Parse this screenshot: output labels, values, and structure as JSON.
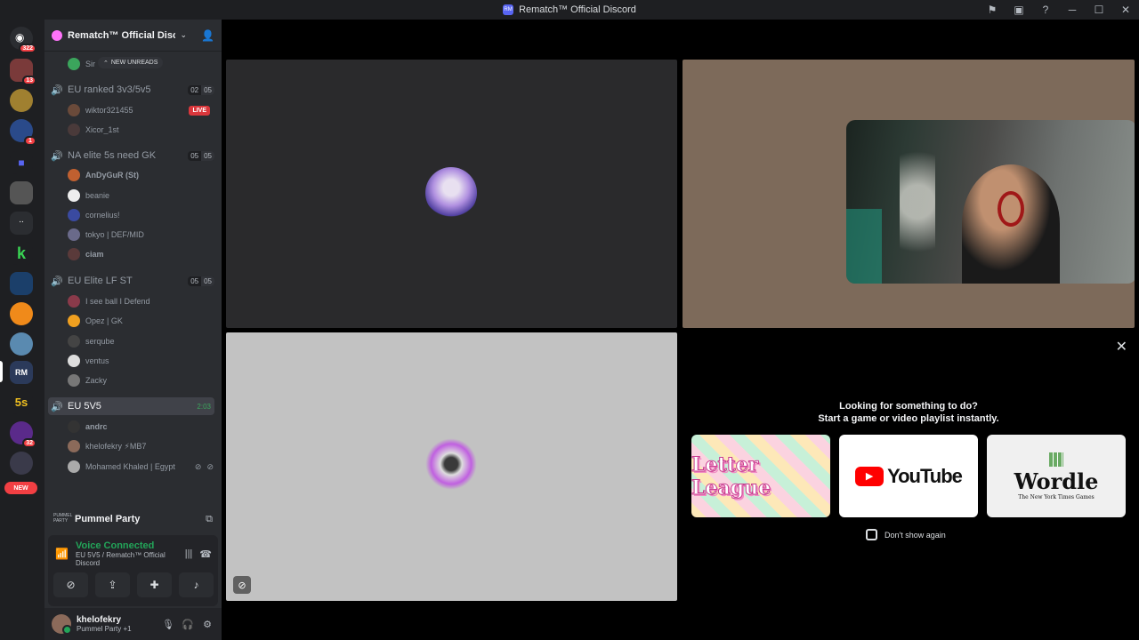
{
  "window": {
    "title": "Rematch™ Official Discord"
  },
  "guilds": {
    "home_badge": "322",
    "items": [
      {
        "badge": "13"
      },
      {
        "badge": ""
      },
      {
        "badge": "1"
      },
      {
        "badge": ""
      },
      {
        "badge": ""
      },
      {
        "badge": ""
      },
      {
        "badge": ""
      },
      {
        "badge": ""
      },
      {
        "badge": ""
      },
      {
        "badge": ""
      },
      {
        "badge": ""
      },
      {
        "badge": ""
      },
      {
        "badge": "32"
      },
      {
        "badge": ""
      }
    ],
    "new_label": "NEW"
  },
  "server": {
    "name": "Rematch™ Official Disco...",
    "new_unreads": "NEW UNREADS",
    "partial_member": "Sir"
  },
  "voice_channels": [
    {
      "name": "EU ranked 3v3/5v5",
      "count": "02",
      "limit": "05",
      "members": [
        "wiktor321455",
        "Xicor_1st"
      ],
      "live": "LIVE"
    },
    {
      "name": "NA elite 5s need GK",
      "count": "05",
      "limit": "05",
      "members": [
        "AnDyGuR (St)",
        "beanie",
        "cornelius!",
        "tokyo | DEF/MID",
        "ciam"
      ]
    },
    {
      "name": "EU Elite LF ST",
      "count": "05",
      "limit": "05",
      "members": [
        "I see ball I Defend",
        "Opez | GK",
        "serqube",
        "ventus",
        "Zacky"
      ]
    },
    {
      "name": "EU 5V5",
      "timer": "2:03",
      "members": [
        "andrc",
        "khelofekry ⚡MB7",
        "Mohamed Khaled | Egypt"
      ]
    }
  ],
  "activity": {
    "name": "Pummel Party",
    "icon_text": "PUMMEL PARTY"
  },
  "voice": {
    "status": "Voice Connected",
    "channel": "EU 5V5 / Rematch™ Official Discord"
  },
  "user": {
    "name": "khelofekry",
    "status": "Pummel Party +1"
  },
  "activities_panel": {
    "line1": "Looking for something to do?",
    "line2": "Start a game or video playlist instantly.",
    "cards": [
      "Letter League",
      "YouTube",
      "Wordle"
    ],
    "wordle_sub": "The New York Times Games",
    "dont_show": "Don't show again"
  }
}
